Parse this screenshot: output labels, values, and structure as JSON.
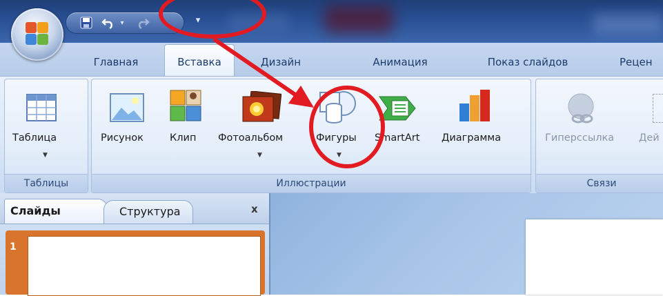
{
  "colors": {
    "accent_red": "#e21b23",
    "ribbon_bg": "#dce8f8",
    "title_bg": "#294f93"
  },
  "qat": {
    "save_icon": "save-icon",
    "undo_icon": "undo-icon",
    "redo_icon": "redo-icon",
    "customize_icon": "chevron-down-icon"
  },
  "tabs": [
    {
      "label": "Главная"
    },
    {
      "label": "Вставка"
    },
    {
      "label": "Дизайн"
    },
    {
      "label": "Анимация"
    },
    {
      "label": "Показ слайдов"
    },
    {
      "label": "Рецен"
    }
  ],
  "ribbon": {
    "groups": [
      {
        "label": "Таблицы",
        "buttons": [
          {
            "label": "Таблица",
            "icon": "table-icon"
          }
        ]
      },
      {
        "label": "Иллюстрации",
        "buttons": [
          {
            "label": "Рисунок",
            "icon": "picture-icon"
          },
          {
            "label": "Клип",
            "icon": "clip-art-icon"
          },
          {
            "label": "Фотоальбом",
            "icon": "photo-album-icon"
          },
          {
            "label": "Фигуры",
            "icon": "shapes-icon"
          },
          {
            "label": "SmartArt",
            "icon": "smartart-icon"
          },
          {
            "label": "Диаграмма",
            "icon": "chart-icon"
          }
        ]
      },
      {
        "label": "Связи",
        "buttons": [
          {
            "label": "Гиперссылка",
            "icon": "hyperlink-icon"
          },
          {
            "label": "Дей",
            "icon": "action-icon"
          }
        ]
      }
    ]
  },
  "panel": {
    "tabs": [
      {
        "label": "Слайды"
      },
      {
        "label": "Структура"
      }
    ],
    "close_label": "x",
    "thumbnails": [
      {
        "number": "1"
      }
    ]
  }
}
